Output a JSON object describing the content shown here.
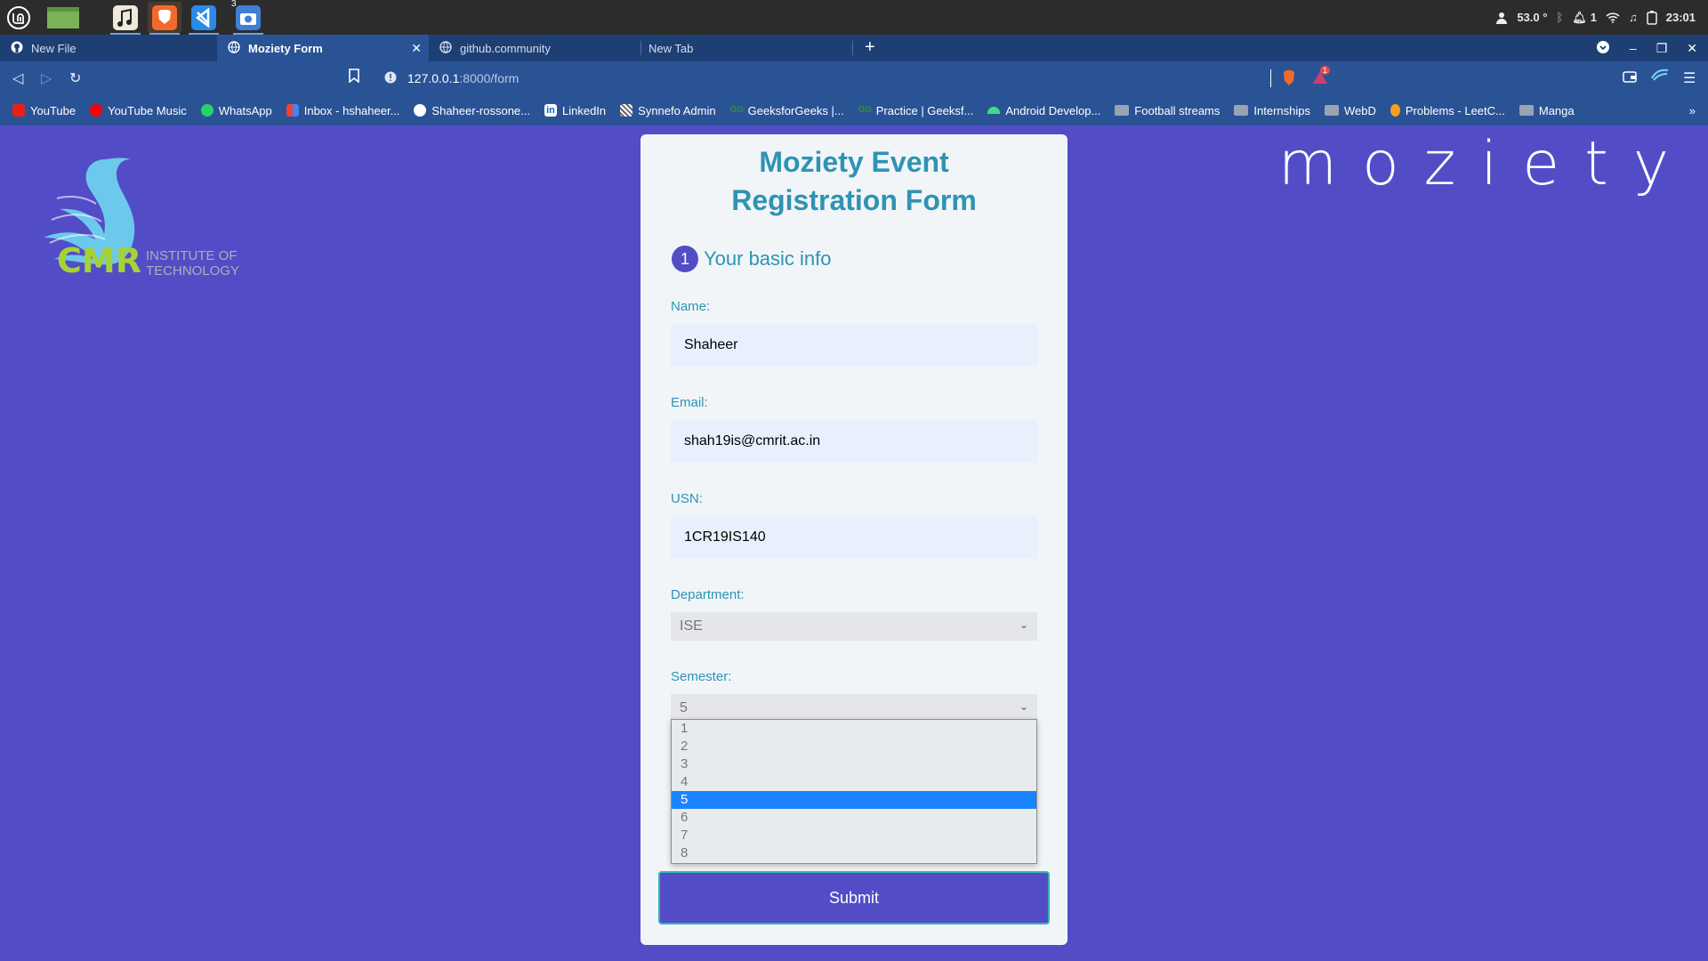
{
  "taskbar": {
    "apps": [
      "mint-menu-icon",
      "files-icon",
      "music-icon",
      "brave-icon",
      "vscode-icon",
      "camera-icon"
    ],
    "camera_badge": "3",
    "tray": {
      "temperature": "53.0 °",
      "notif_count": "1",
      "clock": "23:01"
    }
  },
  "browser": {
    "tabs": [
      {
        "label": "New File"
      },
      {
        "label": "Moziety Form"
      },
      {
        "label": "github.community"
      },
      {
        "label": "New Tab"
      }
    ],
    "url_host": "127.0.0.1",
    "url_path": ":8000/form",
    "shield_badge": "1",
    "bookmarks": [
      {
        "label": "YouTube",
        "icon": "youtube-icon",
        "color": "#e62117"
      },
      {
        "label": "YouTube Music",
        "icon": "youtube-music-icon",
        "color": "#ff0000"
      },
      {
        "label": "WhatsApp",
        "icon": "whatsapp-icon",
        "color": "#25d366"
      },
      {
        "label": "Inbox - hshaheer...",
        "icon": "gmail-icon",
        "color": "#ea4335"
      },
      {
        "label": "Shaheer-rossone...",
        "icon": "github-icon",
        "color": "#ffffff"
      },
      {
        "label": "LinkedIn",
        "icon": "linkedin-icon",
        "color": "#0a66c2"
      },
      {
        "label": "Synnefo Admin",
        "icon": "synnefo-icon",
        "color": "#dddddd"
      },
      {
        "label": "GeeksforGeeks |...",
        "icon": "gfg-icon",
        "color": "#2f8d46"
      },
      {
        "label": "Practice | Geeksf...",
        "icon": "gfg-icon",
        "color": "#2f8d46"
      },
      {
        "label": "Android Develop...",
        "icon": "android-icon",
        "color": "#3ddc84"
      },
      {
        "label": "Football streams",
        "icon": "folder-icon"
      },
      {
        "label": "Internships",
        "icon": "folder-icon"
      },
      {
        "label": "WebD",
        "icon": "folder-icon"
      },
      {
        "label": "Problems - LeetC...",
        "icon": "leetcode-icon",
        "color": "#f89f1b"
      },
      {
        "label": "Manga",
        "icon": "folder-icon"
      }
    ]
  },
  "page": {
    "logo_cmr": "CMR",
    "logo_line1": "INSTITUTE OF",
    "logo_line2": "TECHNOLOGY",
    "brand": "moziety",
    "form": {
      "title": "Moziety Event Registration Form",
      "step_number": "1",
      "step_label": "Your basic info",
      "name_label": "Name:",
      "name_value": "Shaheer",
      "email_label": "Email:",
      "email_value": "shah19is@cmrit.ac.in",
      "usn_label": "USN:",
      "usn_value": "1CR19IS140",
      "department_label": "Department:",
      "department_value": "ISE",
      "semester_label": "Semester:",
      "semester_value": "5",
      "semester_options": [
        "1",
        "2",
        "3",
        "4",
        "5",
        "6",
        "7",
        "8"
      ],
      "semester_selected_index": 4,
      "submit_label": "Submit"
    }
  },
  "colors": {
    "page_bg": "#524dc7",
    "accent_teal": "#2f93b3",
    "tab_bar": "#1d3f74",
    "toolbar": "#2a5396"
  }
}
